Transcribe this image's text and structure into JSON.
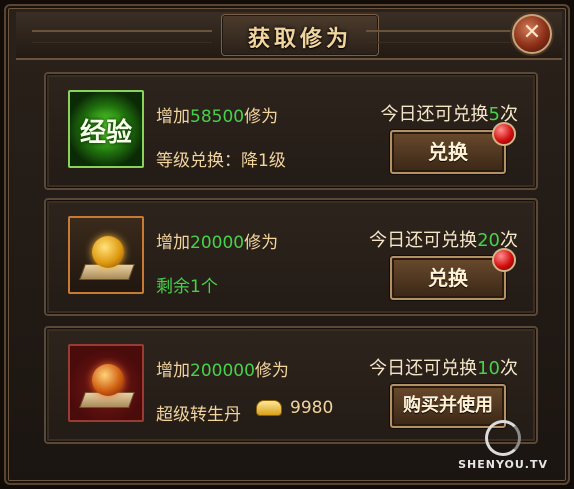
{
  "dialog": {
    "title": "获取修为",
    "close_icon": "close-icon"
  },
  "offers": [
    {
      "icon": "exp-book-icon",
      "icon_text": "经验",
      "gain_prefix": "增加",
      "gain_amount": "58500",
      "gain_suffix": "修为",
      "sub_text": "等级兑换：降1级",
      "limit_prefix": "今日还可兑换",
      "limit_count": "5",
      "limit_suffix": "次",
      "button_label": "兑换",
      "has_notification": true
    },
    {
      "icon": "gold-orb-icon",
      "gain_prefix": "增加",
      "gain_amount": "20000",
      "gain_suffix": "修为",
      "sub_text": "剩余1个",
      "limit_prefix": "今日还可兑换",
      "limit_count": "20",
      "limit_suffix": "次",
      "button_label": "兑换",
      "has_notification": true
    },
    {
      "icon": "fire-orb-icon",
      "gain_prefix": "增加",
      "gain_amount": "200000",
      "gain_suffix": "修为",
      "sub_text": "超级转生丹",
      "cost_value": "9980",
      "limit_prefix": "今日还可兑换",
      "limit_count": "10",
      "limit_suffix": "次",
      "button_label": "购买并使用",
      "has_notification": false
    }
  ],
  "watermark": {
    "text": "SHENYOU.TV"
  },
  "colors": {
    "accent_green": "#47d14b",
    "text_gold": "#f1d49e",
    "button_border": "#b49164",
    "notification_red": "#d40f0f"
  }
}
